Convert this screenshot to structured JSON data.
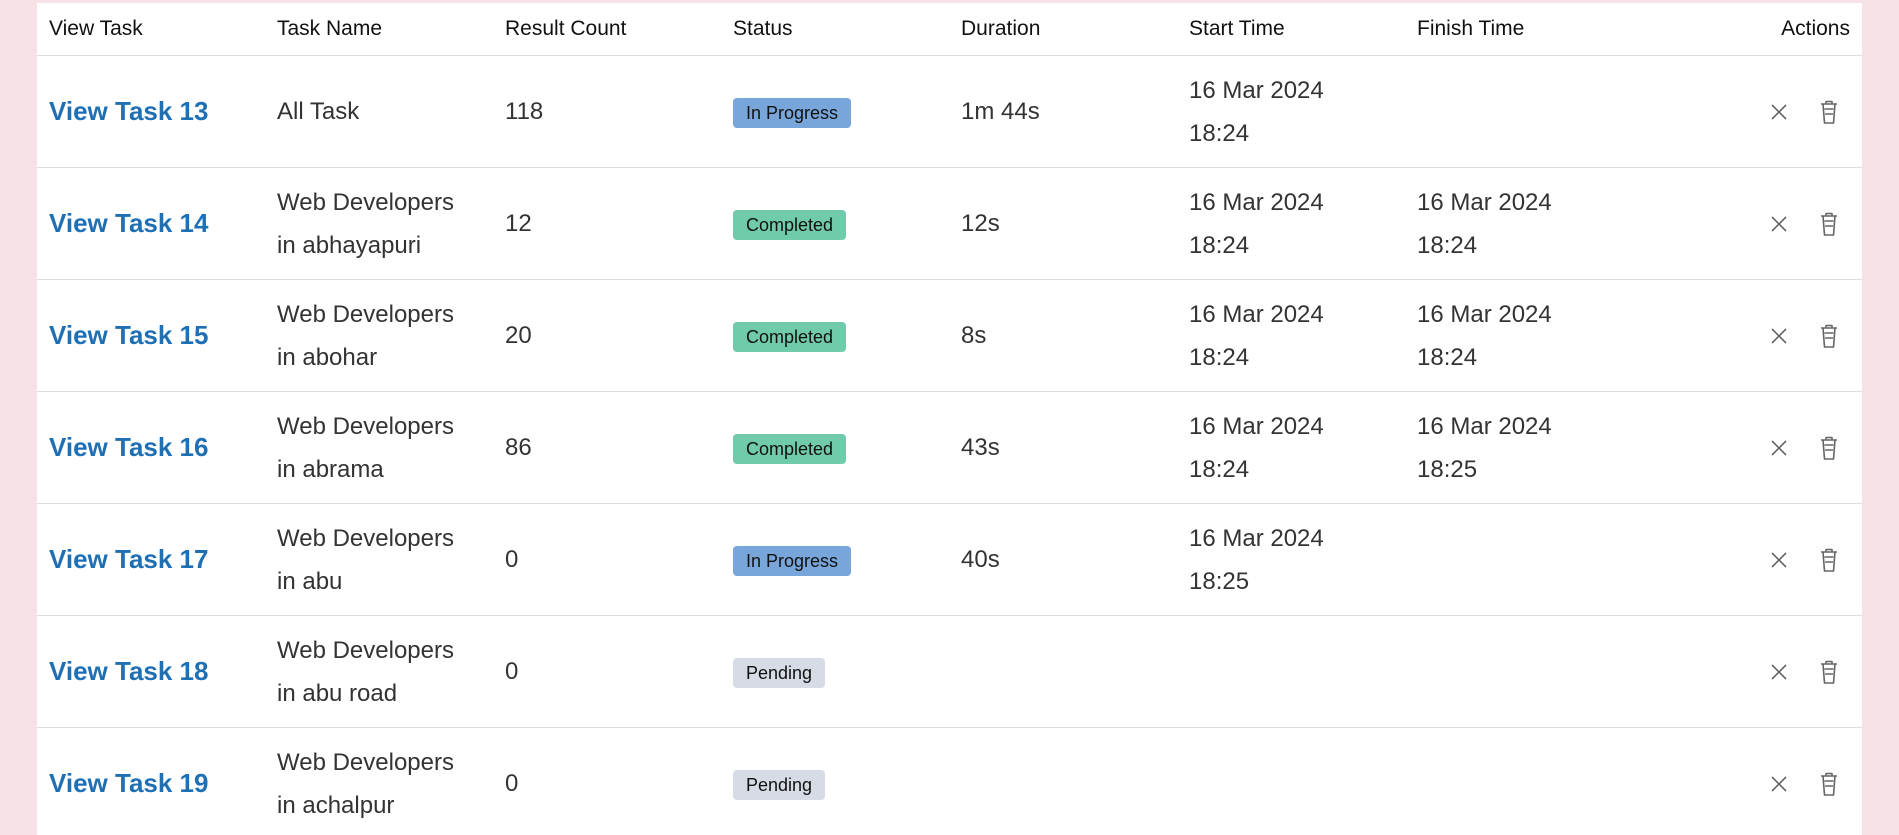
{
  "table": {
    "headers": {
      "view_task": "View Task",
      "task_name": "Task Name",
      "result_count": "Result Count",
      "status": "Status",
      "duration": "Duration",
      "start_time": "Start Time",
      "finish_time": "Finish Time",
      "actions": "Actions"
    },
    "rows": [
      {
        "view": "View Task 13",
        "name_line1": "All Task",
        "name_line2": "",
        "count": "118",
        "status": "In Progress",
        "duration": "1m 44s",
        "start_date": "16 Mar 2024",
        "start_time": "18:24",
        "finish_date": "",
        "finish_time": ""
      },
      {
        "view": "View Task 14",
        "name_line1": "Web Developers",
        "name_line2": "in abhayapuri",
        "count": "12",
        "status": "Completed",
        "duration": "12s",
        "start_date": "16 Mar 2024",
        "start_time": "18:24",
        "finish_date": "16 Mar 2024",
        "finish_time": "18:24"
      },
      {
        "view": "View Task 15",
        "name_line1": "Web Developers",
        "name_line2": "in abohar",
        "count": "20",
        "status": "Completed",
        "duration": "8s",
        "start_date": "16 Mar 2024",
        "start_time": "18:24",
        "finish_date": "16 Mar 2024",
        "finish_time": "18:24"
      },
      {
        "view": "View Task 16",
        "name_line1": "Web Developers",
        "name_line2": "in abrama",
        "count": "86",
        "status": "Completed",
        "duration": "43s",
        "start_date": "16 Mar 2024",
        "start_time": "18:24",
        "finish_date": "16 Mar 2024",
        "finish_time": "18:25"
      },
      {
        "view": "View Task 17",
        "name_line1": "Web Developers",
        "name_line2": "in abu",
        "count": "0",
        "status": "In Progress",
        "duration": "40s",
        "start_date": "16 Mar 2024",
        "start_time": "18:25",
        "finish_date": "",
        "finish_time": ""
      },
      {
        "view": "View Task 18",
        "name_line1": "Web Developers",
        "name_line2": "in abu road",
        "count": "0",
        "status": "Pending",
        "duration": "",
        "start_date": "",
        "start_time": "",
        "finish_date": "",
        "finish_time": ""
      },
      {
        "view": "View Task 19",
        "name_line1": "Web Developers",
        "name_line2": "in achalpur",
        "count": "0",
        "status": "Pending",
        "duration": "",
        "start_date": "",
        "start_time": "",
        "finish_date": "",
        "finish_time": ""
      }
    ]
  },
  "status_colors": {
    "In Progress": "#78a6da",
    "Completed": "#6fcba9",
    "Pending": "#d6dbe5"
  },
  "icons": {
    "cancel": "close-icon",
    "delete": "trash-icon"
  }
}
